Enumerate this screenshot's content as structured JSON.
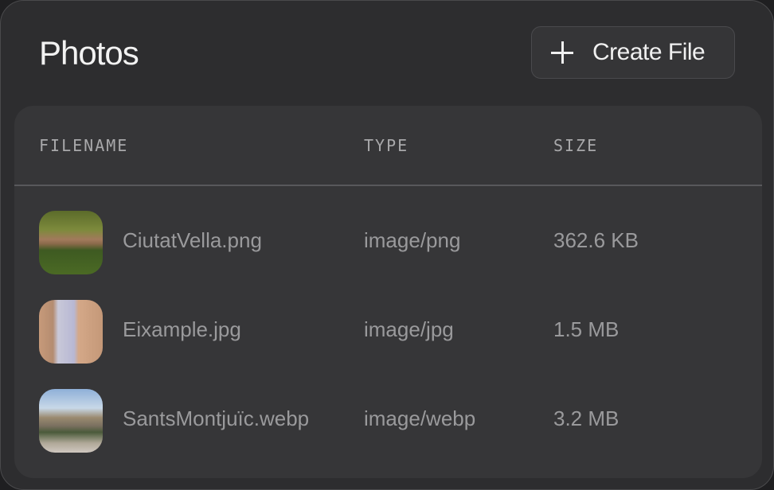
{
  "header": {
    "title": "Photos",
    "create_label": "Create File",
    "create_icon": "plus-icon"
  },
  "table": {
    "columns": [
      "FILENAME",
      "TYPE",
      "SIZE"
    ],
    "rows": [
      {
        "filename": "CiutatVella.png",
        "type": "image/png",
        "size": "362.6 KB"
      },
      {
        "filename": "Eixample.jpg",
        "type": "image/jpg",
        "size": "1.5 MB"
      },
      {
        "filename": "SantsMontjuïc.webp",
        "type": "image/webp",
        "size": "3.2 MB"
      }
    ]
  }
}
